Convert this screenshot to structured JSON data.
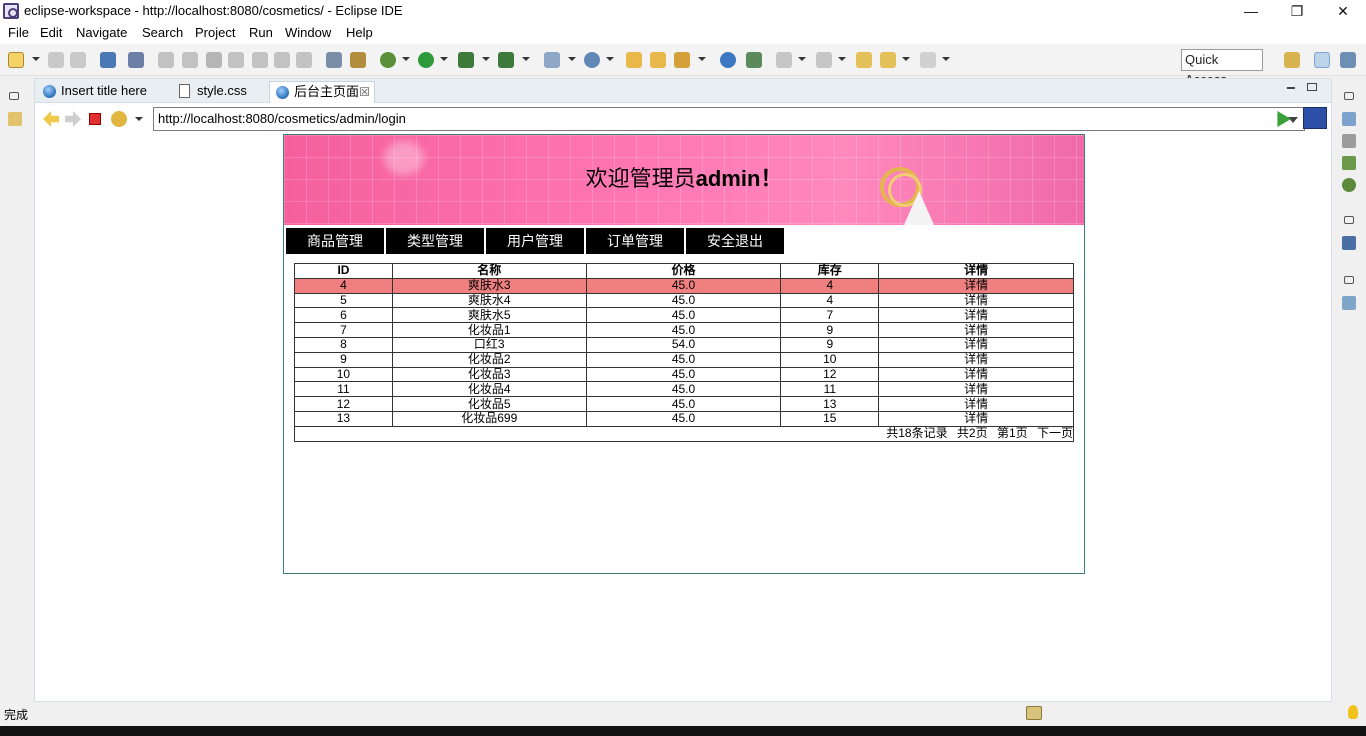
{
  "window": {
    "title": "eclipse-workspace - http://localhost:8080/cosmetics/ - Eclipse IDE",
    "minimize": "—",
    "restore": "❐",
    "close": "✕"
  },
  "menu": [
    "File",
    "Edit",
    "Navigate",
    "Search",
    "Project",
    "Run",
    "Window",
    "Help"
  ],
  "toolbar": {
    "quick_access": "Quick Access"
  },
  "tabs": [
    {
      "label": "Insert title here",
      "icon": "globe-icon"
    },
    {
      "label": "style.css",
      "icon": "css-file-icon"
    },
    {
      "label": "后台主页面",
      "icon": "globe-icon",
      "close": "☒"
    }
  ],
  "browser": {
    "url": "http://localhost:8080/cosmetics/admin/login"
  },
  "page": {
    "welcome_prefix": "欢迎管理员",
    "welcome_user": "admin",
    "welcome_suffix": "！",
    "nav": [
      "商品管理",
      "类型管理",
      "用户管理",
      "订单管理",
      "安全退出"
    ],
    "table": {
      "headers": [
        "ID",
        "名称",
        "价格",
        "库存",
        "详情"
      ],
      "rows": [
        [
          "4",
          "爽肤水3",
          "45.0",
          "4",
          "详情"
        ],
        [
          "5",
          "爽肤水4",
          "45.0",
          "4",
          "详情"
        ],
        [
          "6",
          "爽肤水5",
          "45.0",
          "7",
          "详情"
        ],
        [
          "7",
          "化妆品1",
          "45.0",
          "9",
          "详情"
        ],
        [
          "8",
          "口红3",
          "54.0",
          "9",
          "详情"
        ],
        [
          "9",
          "化妆品2",
          "45.0",
          "10",
          "详情"
        ],
        [
          "10",
          "化妆品3",
          "45.0",
          "12",
          "详情"
        ],
        [
          "11",
          "化妆品4",
          "45.0",
          "11",
          "详情"
        ],
        [
          "12",
          "化妆品5",
          "45.0",
          "13",
          "详情"
        ],
        [
          "13",
          "化妆品699",
          "45.0",
          "15",
          "详情"
        ]
      ],
      "highlight_color": "#f08080"
    },
    "pager": {
      "total_records": "共18条记录",
      "total_pages": "共2页",
      "current_page": "第1页",
      "next": "下一页"
    },
    "banner_color": "#ff77b3"
  },
  "status": {
    "message": "完成"
  }
}
